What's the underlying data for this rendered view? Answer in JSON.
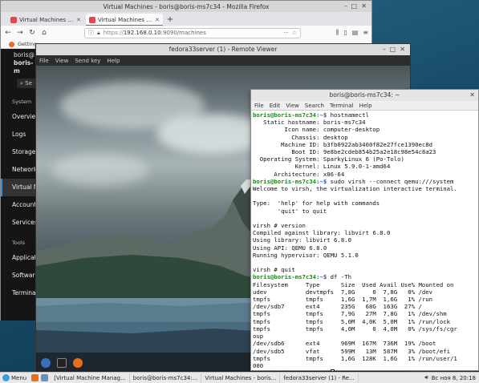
{
  "firefox": {
    "window_title": "Virtual Machines - boris@boris-ms7c34 - Mozilla Firefox",
    "tabs": [
      {
        "label": "Virtual Machines - boris@"
      },
      {
        "label": "Virtual Machines - boris@"
      }
    ],
    "url_scheme": "https://",
    "url_host": "192.168.0.10",
    "url_path": ":9090/machines",
    "bookmark": "Getting"
  },
  "cockpit": {
    "host_line1": "boris@",
    "host_line2": "boris-m",
    "search_label": "Se",
    "section_system": "System",
    "nav_items": [
      "Overview",
      "Logs",
      "Storage",
      "Networking",
      "Virtual Machines",
      "Accounts",
      "Services"
    ],
    "section_tools": "Tools",
    "tool_items": [
      "Applications",
      "Software Updates",
      "Terminal"
    ]
  },
  "remote_viewer": {
    "title": "fedora33server (1) - Remote Viewer",
    "menu": [
      "File",
      "View",
      "Send key",
      "Help"
    ]
  },
  "terminal": {
    "title": "boris@boris-ms7c34: ~",
    "menu": [
      "File",
      "Edit",
      "View",
      "Search",
      "Terminal",
      "Help"
    ],
    "prompt_user": "boris@boris-ms7c34",
    "prompt_path": ":~$ ",
    "cmd1": "hostnamectl",
    "hostnamectl_output": "   Static hostname: boris-ms7c34\n         Icon name: computer-desktop\n           Chassis: desktop\n        Machine ID: b3fb0922ab3460f82e27fce1390ec8d\n           Boot ID: 9e8be2cdeb854b25a2e18c98e54c8a23\n  Operating System: SparkyLinux 6 (Po-Tolo)\n            Kernel: Linux 5.9.0-1-amd64\n      Architecture: x86-64",
    "cmd2": "sudo virsh --connect qemu:///system",
    "virsh_welcome": "Welcome to virsh, the virtualization interactive terminal.\n\nType:  'help' for help with commands\n       'quit' to quit\n\nvirsh # version\nCompiled against library: libvirt 6.8.0\nUsing library: libvirt 6.8.0\nUsing API: QEMU 6.8.0\nRunning hypervisor: QEMU 5.1.0\n\nvirsh # quit",
    "cmd3": "df -Th",
    "df_output": "Filesystem     Type      Size  Used Avail Use% Mounted on\nudev           devtmpfs  7,8G     0  7,8G   0% /dev\ntmpfs          tmpfs     1,6G  1,7M  1,6G   1% /run\n/dev/sdb7      ext4      235G   68G  163G  27% /\ntmpfs          tmpfs     7,9G   27M  7,8G   1% /dev/shm\ntmpfs          tmpfs     5,0M  4,0K  5,0M   1% /run/lock\ntmpfs          tmpfs     4,0M     0  4,0M   0% /sys/fs/cgr\noup\n/dev/sdb6      ext4      969M  167M  736M  19% /boot\n/dev/sdb5      vfat      599M   13M  587M   3% /boot/efi\ntmpfs          tmpfs     1,6G  128K  1,6G   1% /run/user/1\n000"
  },
  "taskbar": {
    "menu_label": "Menu",
    "tasks": [
      "[Virtual Machine Manag...",
      "boris@boris-ms7c34:...",
      "Virtual Machines - boris...",
      "fedora33server (1) - Re..."
    ],
    "date": "Вс ноя 8, 20:18"
  },
  "colors": {
    "prompt_green": "#1a8a1a",
    "path_blue": "#2255bb",
    "cockpit_bg": "#151515",
    "accent": "#3d8fd6"
  }
}
